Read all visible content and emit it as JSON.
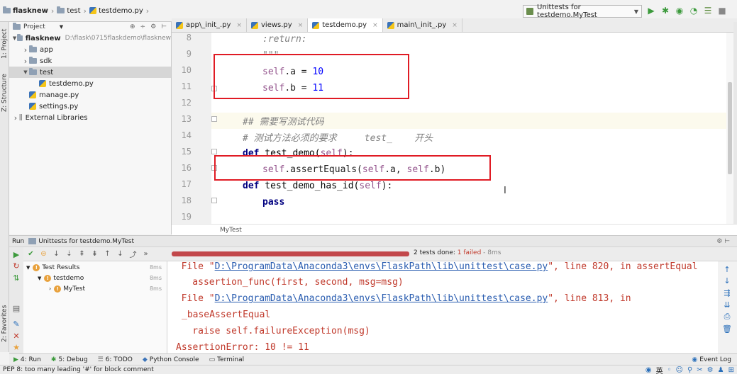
{
  "breadcrumb": {
    "items": [
      "flasknew",
      "test",
      "testdemo.py"
    ]
  },
  "run_config": {
    "label": "Unittests for testdemo.MyTest"
  },
  "toolbar_icons": [
    "run-icon",
    "debug-icon",
    "coverage-icon",
    "profile-icon",
    "build-icon",
    "stop-icon"
  ],
  "left_stripe": {
    "project_tab": "1: Project",
    "structure_tab": "Z: Structure",
    "favorites_tab": "2: Favorites"
  },
  "project_panel": {
    "title": "Project",
    "tree": [
      {
        "name": "flasknew",
        "path": "D:\\flask\\0715flaskdemo\\flasknew",
        "type": "folder",
        "expanded": true,
        "level": 0
      },
      {
        "name": "app",
        "type": "folder",
        "expanded": false,
        "level": 1
      },
      {
        "name": "sdk",
        "type": "folder",
        "expanded": false,
        "level": 1
      },
      {
        "name": "test",
        "type": "folder",
        "expanded": true,
        "level": 1
      },
      {
        "name": "testdemo.py",
        "type": "py",
        "level": 2
      },
      {
        "name": "manage.py",
        "type": "py",
        "level": 1
      },
      {
        "name": "settings.py",
        "type": "py",
        "level": 1
      },
      {
        "name": "External Libraries",
        "type": "lib",
        "expanded": false,
        "level": 0
      }
    ]
  },
  "editor": {
    "tabs": [
      {
        "label": "app\\_init_.py",
        "active": false
      },
      {
        "label": "views.py",
        "active": false
      },
      {
        "label": "testdemo.py",
        "active": true
      },
      {
        "label": "main\\_init_.py",
        "active": false
      }
    ],
    "line_numbers": [
      "8",
      "9",
      "10",
      "11",
      "12",
      "13",
      "14",
      "15",
      "16",
      "17",
      "18",
      "19"
    ],
    "lines": {
      "l8": ":return:",
      "l9": "\"\"\"",
      "l10_self": "self",
      "l10_rest": ".a = ",
      "l10_num": "10",
      "l11_self": "self",
      "l11_rest": ".b = ",
      "l11_num": "11",
      "l13": "## 需要写测试代码",
      "l14": "# 测试方法必须的要求     test_    开头",
      "l15_kw": "def",
      "l15_fn": " test_demo(",
      "l15_self": "self",
      "l15_end": "):",
      "l16_self1": "self",
      "l16_mid": ".assertEquals(",
      "l16_self2": "self",
      "l16_mid2": ".a, ",
      "l16_self3": "self",
      "l16_end": ".b)",
      "l17_kw": "def",
      "l17_fn": " test_demo_has_id(",
      "l17_self": "self",
      "l17_end": "):",
      "l18_kw": "pass"
    },
    "bottom_crumb": "MyTest"
  },
  "run_panel": {
    "title": "Run",
    "config": "Unittests for testdemo.MyTest",
    "progress": {
      "fraction": 1.0,
      "status_prefix": "2 tests done: ",
      "failed": "1 failed",
      "time": " - 8ms"
    },
    "results": [
      {
        "label": "Test Results",
        "time": "8ms",
        "level": 0
      },
      {
        "label": "testdemo",
        "time": "8ms",
        "level": 1
      },
      {
        "label": "MyTest",
        "time": "8ms",
        "level": 2
      }
    ],
    "console": {
      "c1_pre": "  File \"",
      "c1_link": "D:\\ProgramData\\Anaconda3\\envs\\FlaskPath\\lib\\unittest\\case.py",
      "c1_post": "\", line 820, in assertEqual",
      "c2": "    assertion_func(first, second, msg=msg)",
      "c3_pre": "  File \"",
      "c3_link": "D:\\ProgramData\\Anaconda3\\envs\\FlaskPath\\lib\\unittest\\case.py",
      "c3_post": "\", line 813, in",
      "c4": "_baseAssertEqual",
      "c5": "    raise self.failureException(msg)",
      "c6": "AssertionError: 10 != 11"
    }
  },
  "bottom_tabs": {
    "run": "4: Run",
    "debug": "5: Debug",
    "todo": "6: TODO",
    "python_console": "Python Console",
    "terminal": "Terminal",
    "event_log": "Event Log"
  },
  "status": {
    "message": "PEP 8: too many leading '#' for block comment",
    "ime": "英"
  }
}
